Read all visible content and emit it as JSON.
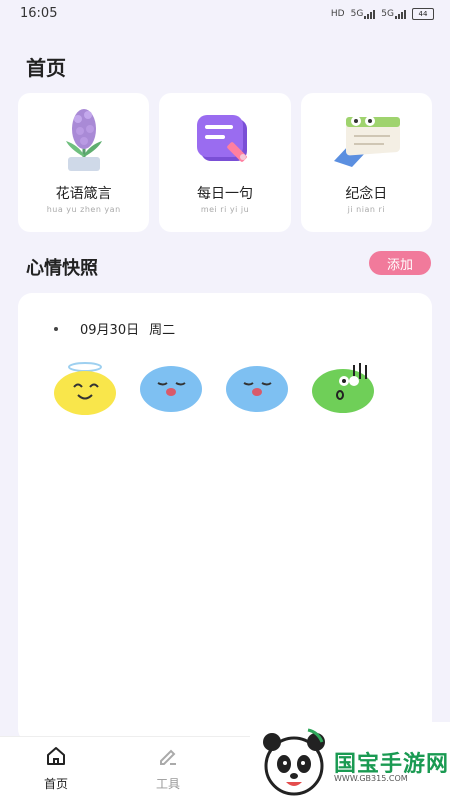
{
  "status": {
    "time": "16:05",
    "network1": "5G",
    "network2": "5G",
    "battery": "44"
  },
  "page": {
    "title": "首页"
  },
  "cards": [
    {
      "title": "花语箴言",
      "pinyin": "hua yu zhen yan",
      "icon": "hyacinth-icon"
    },
    {
      "title": "每日一句",
      "pinyin": "mei ri yi ju",
      "icon": "note-pencil-icon"
    },
    {
      "title": "纪念日",
      "pinyin": "ji nian ri",
      "icon": "calendar-icon"
    }
  ],
  "mood": {
    "section_title": "心情快照",
    "add_label": "添加",
    "date": "09月30日",
    "weekday": "周二",
    "faces": [
      "angel-face-icon",
      "sad-face-icon",
      "sad-face-icon",
      "frozen-face-icon"
    ]
  },
  "tabs": [
    {
      "label": "首页",
      "icon": "home-icon"
    },
    {
      "label": "工具",
      "icon": "edit-icon"
    }
  ],
  "watermark": {
    "text": "国宝手游网",
    "sub": "WWW.GB315.COM"
  },
  "colors": {
    "accent": "#f17a9b",
    "background": "#f3f2fb",
    "watermark": "#1a9a52"
  }
}
